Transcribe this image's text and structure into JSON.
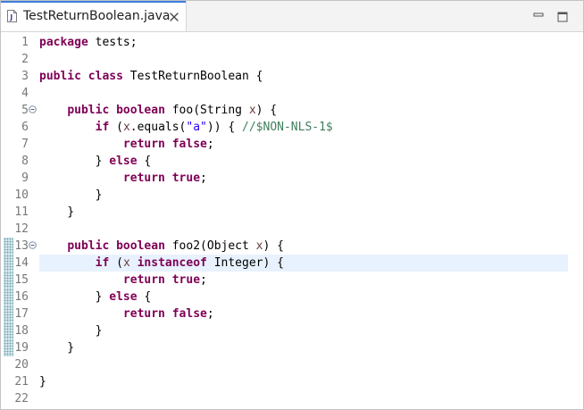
{
  "tab": {
    "title": "TestReturnBoolean.java",
    "icon": "java-file-icon"
  },
  "colors": {
    "keyword": "#7f0055",
    "string": "#2a00ff",
    "comment": "#3f7f5f",
    "parameter": "#6a3e3e",
    "current_line": "#e8f2fe",
    "tab_accent": "#3b7ddd"
  },
  "editor": {
    "current_line_number": "14",
    "lines": [
      {
        "n": "1",
        "tokens": [
          [
            "kw",
            "package"
          ],
          [
            "id",
            " tests;"
          ]
        ]
      },
      {
        "n": "2",
        "tokens": []
      },
      {
        "n": "3",
        "tokens": [
          [
            "kw",
            "public"
          ],
          [
            "id",
            " "
          ],
          [
            "kw",
            "class"
          ],
          [
            "id",
            " TestReturnBoolean {"
          ]
        ]
      },
      {
        "n": "4",
        "tokens": []
      },
      {
        "n": "5",
        "fold": true,
        "tokens": [
          [
            "id",
            "    "
          ],
          [
            "kw",
            "public"
          ],
          [
            "id",
            " "
          ],
          [
            "kw",
            "boolean"
          ],
          [
            "id",
            " foo(String "
          ],
          [
            "vr",
            "x"
          ],
          [
            "id",
            ") {"
          ]
        ]
      },
      {
        "n": "6",
        "tokens": [
          [
            "id",
            "        "
          ],
          [
            "kw",
            "if"
          ],
          [
            "id",
            " ("
          ],
          [
            "vr",
            "x"
          ],
          [
            "id",
            ".equals("
          ],
          [
            "str",
            "\"a\""
          ],
          [
            "id",
            ")) { "
          ],
          [
            "cm",
            "//$NON-NLS-1$"
          ]
        ]
      },
      {
        "n": "7",
        "tokens": [
          [
            "id",
            "            "
          ],
          [
            "kw",
            "return"
          ],
          [
            "id",
            " "
          ],
          [
            "kw",
            "false"
          ],
          [
            "id",
            ";"
          ]
        ]
      },
      {
        "n": "8",
        "tokens": [
          [
            "id",
            "        } "
          ],
          [
            "kw",
            "else"
          ],
          [
            "id",
            " {"
          ]
        ]
      },
      {
        "n": "9",
        "tokens": [
          [
            "id",
            "            "
          ],
          [
            "kw",
            "return"
          ],
          [
            "id",
            " "
          ],
          [
            "kw",
            "true"
          ],
          [
            "id",
            ";"
          ]
        ]
      },
      {
        "n": "10",
        "tokens": [
          [
            "id",
            "        }"
          ]
        ]
      },
      {
        "n": "11",
        "tokens": [
          [
            "id",
            "    }"
          ]
        ]
      },
      {
        "n": "12",
        "tokens": []
      },
      {
        "n": "13",
        "fold": true,
        "changed": true,
        "tokens": [
          [
            "id",
            "    "
          ],
          [
            "kw",
            "public"
          ],
          [
            "id",
            " "
          ],
          [
            "kw",
            "boolean"
          ],
          [
            "id",
            " foo2(Object "
          ],
          [
            "vr",
            "x"
          ],
          [
            "id",
            ") {"
          ]
        ]
      },
      {
        "n": "14",
        "changed": true,
        "current": true,
        "tokens": [
          [
            "id",
            "        "
          ],
          [
            "kw",
            "if"
          ],
          [
            "id",
            " ("
          ],
          [
            "vr",
            "x"
          ],
          [
            "id",
            " "
          ],
          [
            "kw",
            "instanceof"
          ],
          [
            "id",
            " Integer) {"
          ]
        ]
      },
      {
        "n": "15",
        "changed": true,
        "tokens": [
          [
            "id",
            "            "
          ],
          [
            "kw",
            "return"
          ],
          [
            "id",
            " "
          ],
          [
            "kw",
            "true"
          ],
          [
            "id",
            ";"
          ]
        ]
      },
      {
        "n": "16",
        "changed": true,
        "tokens": [
          [
            "id",
            "        } "
          ],
          [
            "kw",
            "else"
          ],
          [
            "id",
            " {"
          ]
        ]
      },
      {
        "n": "17",
        "changed": true,
        "tokens": [
          [
            "id",
            "            "
          ],
          [
            "kw",
            "return"
          ],
          [
            "id",
            " "
          ],
          [
            "kw",
            "false"
          ],
          [
            "id",
            ";"
          ]
        ]
      },
      {
        "n": "18",
        "changed": true,
        "tokens": [
          [
            "id",
            "        }"
          ]
        ]
      },
      {
        "n": "19",
        "changed": true,
        "tokens": [
          [
            "id",
            "    }"
          ]
        ]
      },
      {
        "n": "20",
        "tokens": []
      },
      {
        "n": "21",
        "tokens": [
          [
            "id",
            "}"
          ]
        ]
      },
      {
        "n": "22",
        "tokens": []
      }
    ]
  }
}
